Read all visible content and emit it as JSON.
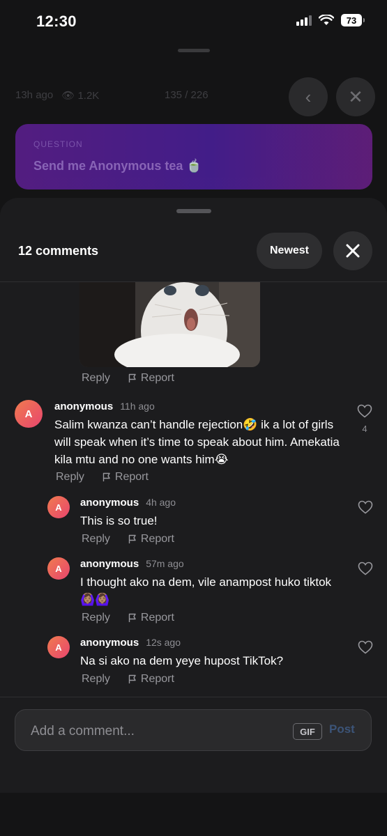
{
  "status_bar": {
    "time": "12:30",
    "battery": "73"
  },
  "background": {
    "time_ago": "13h ago",
    "views": "1.2K",
    "position": "135 / 226",
    "question_label": "QUESTION",
    "question_text": "Send me Anonymous tea 🍵"
  },
  "sheet": {
    "title": "12 comments",
    "sort_label": "Newest",
    "reply_label": "Reply",
    "report_label": "Report"
  },
  "comments": [
    {
      "avatar": "A",
      "user": "anonymous",
      "time": "11h ago",
      "text": "Salim kwanza can’t handle rejection🤣 ik a lot of girls will speak when it’s time to speak about him. Amekatia kila mtu and no one wants him😭",
      "likes": "4",
      "replies": [
        {
          "avatar": "A",
          "user": "anonymous",
          "time": "4h ago",
          "text": "This is so true!"
        },
        {
          "avatar": "A",
          "user": "anonymous",
          "time": "57m ago",
          "text": "I thought ako na dem, vile anampost huko tiktok 🙆🏽‍♀️🙆🏽‍♀️"
        },
        {
          "avatar": "A",
          "user": "anonymous",
          "time": "12s ago",
          "text": "Na si ako na dem yeye hupost TikTok?"
        }
      ]
    }
  ],
  "composer": {
    "placeholder": "Add a comment...",
    "gif_label": "GIF",
    "post_label": "Post"
  },
  "colors": {
    "accent_post": "#3c5478",
    "avatar_gradient_start": "#f07b4f",
    "avatar_gradient_end": "#e8456e",
    "question_card": "#5e1f93"
  }
}
